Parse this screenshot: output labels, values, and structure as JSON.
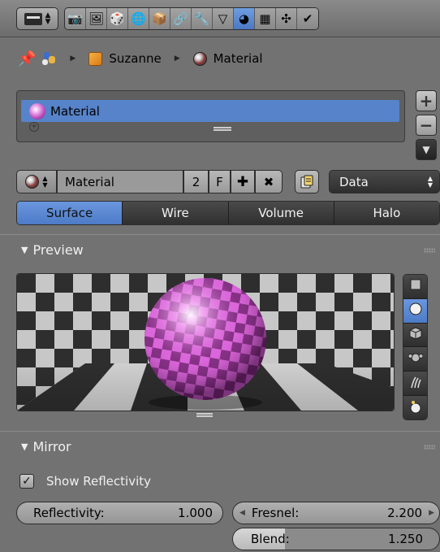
{
  "header": {
    "editor_type_icon": "properties-editor-icon",
    "context_tabs": [
      {
        "id": "render",
        "icon": "camera-icon",
        "glyph": "📷",
        "active": false
      },
      {
        "id": "render-layers",
        "icon": "render-layers-icon",
        "glyph": "🖼",
        "active": false
      },
      {
        "id": "scene",
        "icon": "scene-icon",
        "glyph": "🎲",
        "active": false
      },
      {
        "id": "world",
        "icon": "world-icon",
        "glyph": "🌐",
        "active": false
      },
      {
        "id": "object",
        "icon": "object-icon",
        "glyph": "📦",
        "active": false
      },
      {
        "id": "constraints",
        "icon": "constraints-icon",
        "glyph": "🔗",
        "active": false
      },
      {
        "id": "modifiers",
        "icon": "wrench-icon",
        "glyph": "🔧",
        "active": false
      },
      {
        "id": "data",
        "icon": "mesh-data-icon",
        "glyph": "▽",
        "active": false
      },
      {
        "id": "material",
        "icon": "material-icon",
        "glyph": "◕",
        "active": true
      },
      {
        "id": "texture",
        "icon": "texture-icon",
        "glyph": "▦",
        "active": false
      },
      {
        "id": "particles",
        "icon": "particles-icon",
        "glyph": "✣",
        "active": false
      },
      {
        "id": "physics",
        "icon": "physics-icon",
        "glyph": "✔",
        "active": false
      }
    ]
  },
  "breadcrumb": {
    "object_name": "Suzanne",
    "material_name": "Material"
  },
  "material_slots": {
    "items": [
      {
        "name": "Material",
        "selected": true
      }
    ],
    "add_label": "+",
    "remove_label": "−",
    "specials_label": "▼"
  },
  "datablock": {
    "name": "Material",
    "users": "2",
    "fake_user": "F",
    "new_label": "✚",
    "unlink_label": "✖",
    "link": "Data"
  },
  "material_type_tabs": [
    {
      "label": "Surface",
      "active": true
    },
    {
      "label": "Wire",
      "active": false
    },
    {
      "label": "Volume",
      "active": false
    },
    {
      "label": "Halo",
      "active": false
    }
  ],
  "preview_panel": {
    "title": "Preview",
    "preview_types": [
      {
        "name": "flat",
        "icon": "plane-icon",
        "active": false
      },
      {
        "name": "sphere",
        "icon": "sphere-icon",
        "active": true
      },
      {
        "name": "cube",
        "icon": "cube-icon",
        "active": false
      },
      {
        "name": "monkey",
        "icon": "monkey-icon",
        "active": false
      },
      {
        "name": "hair",
        "icon": "hair-icon",
        "active": false
      },
      {
        "name": "sphere-sky",
        "icon": "sky-sphere-icon",
        "active": false
      }
    ]
  },
  "mirror_panel": {
    "title": "Mirror",
    "show_reflectivity_label": "Show Reflectivity",
    "show_reflectivity": true,
    "reflectivity": {
      "label": "Reflectivity:",
      "value": "1.000"
    },
    "fresnel": {
      "label": "Fresnel:",
      "value": "2.200"
    },
    "blend": {
      "label": "Blend:",
      "value": "1.250",
      "fraction": 0.25
    }
  },
  "colors": {
    "background": "#727272",
    "accent_blue": "#5683c9",
    "dark_button": "#2e2e2e",
    "material_pink": "#c04fc0"
  }
}
